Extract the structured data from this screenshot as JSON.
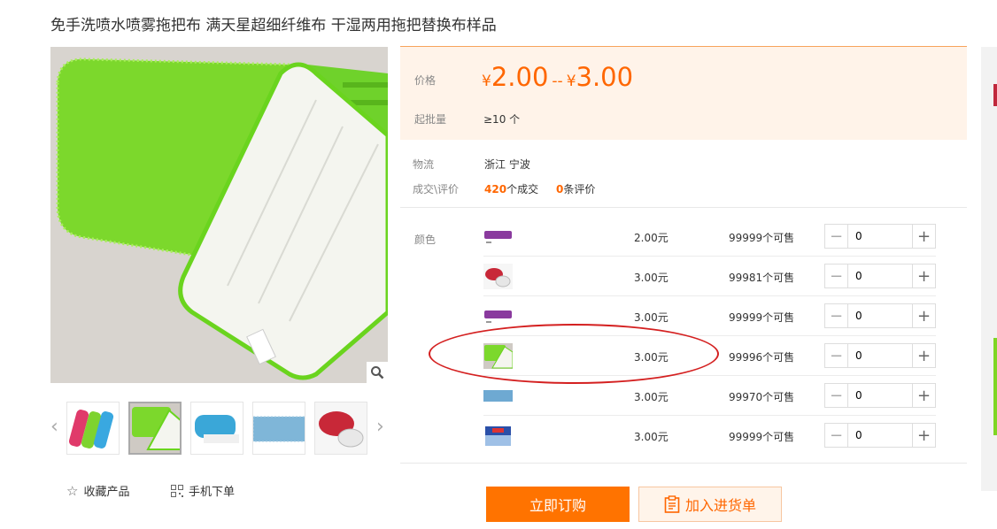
{
  "product": {
    "title": "免手洗喷水喷雾拖把布 满天星超细纤维布 干湿两用拖把替换布样品"
  },
  "gallery": {
    "zoom_icon": "magnifier-icon",
    "prev_icon": "chevron-left-icon",
    "next_icon": "chevron-right-icon",
    "thumbs": [
      "multi-color mop pads",
      "green mop pad",
      "blue mop pad",
      "blue chenille",
      "red mop pad"
    ]
  },
  "actions": {
    "favorite_label": "收藏产品",
    "favorite_icon": "star-icon",
    "mobile_label": "手机下单",
    "mobile_icon": "qr-code-icon"
  },
  "price_panel": {
    "price_label": "价格",
    "currency": "¥",
    "price_min": "2.00",
    "price_sep": "--",
    "price_max": "3.00",
    "moq_label": "起批量",
    "moq_value": "≥10 个"
  },
  "logistics": {
    "label": "物流",
    "value": "浙江 宁波"
  },
  "deals": {
    "label": "成交\\评价",
    "deals_count": "420",
    "deals_suffix": "个成交",
    "reviews_count": "0",
    "reviews_suffix": "条评价"
  },
  "sku": {
    "color_label": "颜色",
    "rows": [
      {
        "price": "2.00元",
        "stock": "99999个可售",
        "qty": "0",
        "swatch": "purple"
      },
      {
        "price": "3.00元",
        "stock": "99981个可售",
        "qty": "0",
        "swatch": "red"
      },
      {
        "price": "3.00元",
        "stock": "99999个可售",
        "qty": "0",
        "swatch": "purple"
      },
      {
        "price": "3.00元",
        "stock": "99996个可售",
        "qty": "0",
        "swatch": "green"
      },
      {
        "price": "3.00元",
        "stock": "99970个可售",
        "qty": "0",
        "swatch": "blue-chenille"
      },
      {
        "price": "3.00元",
        "stock": "99999个可售",
        "qty": "0",
        "swatch": "blue-box"
      }
    ],
    "minus_icon": "minus-icon",
    "plus_icon": "plus-icon"
  },
  "buttons": {
    "order_label": "立即订购",
    "cart_label": "加入进货单",
    "cart_icon": "clipboard-icon"
  },
  "colors": {
    "accent": "#ff6600",
    "order_button": "#ff7300",
    "price_bg": "#fff3e9",
    "highlight": "#d42020"
  }
}
